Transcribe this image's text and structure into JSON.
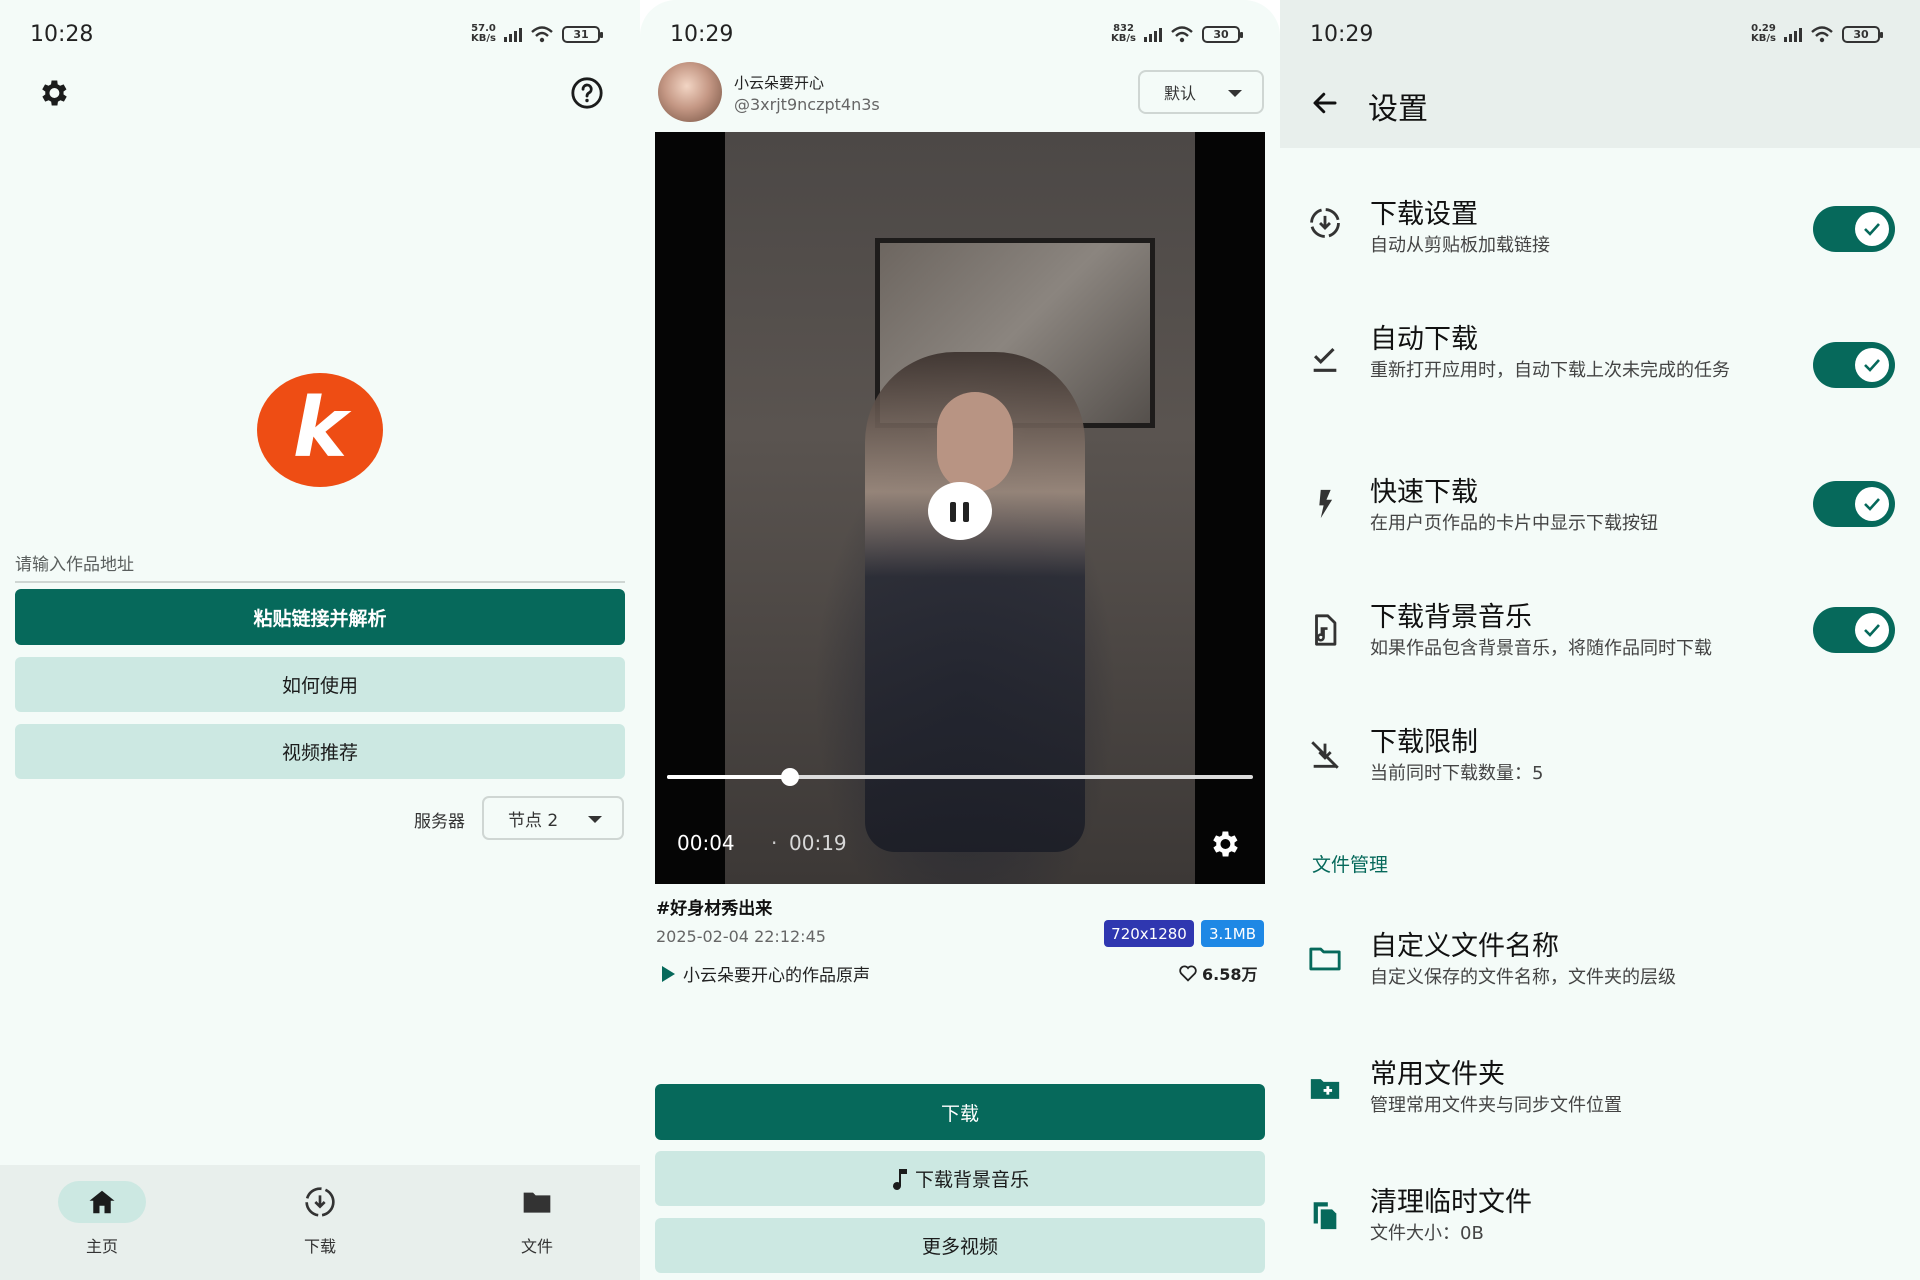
{
  "panel_home": {
    "status": {
      "time": "10:28",
      "net_top": "57.0",
      "net_bottom": "KB/s",
      "battery": "31"
    },
    "logo_letter": "k",
    "url_input": {
      "placeholder": "请输入作品地址"
    },
    "paste_button": "粘贴链接并解析",
    "howto_button": "如何使用",
    "recommend_button": "视频推荐",
    "server_label": "服务器",
    "server_value": "节点 2",
    "nav": [
      {
        "label": "主页",
        "icon": "home-icon",
        "active": true
      },
      {
        "label": "下载",
        "icon": "download-icon",
        "active": false
      },
      {
        "label": "文件",
        "icon": "folder-icon",
        "active": false
      }
    ]
  },
  "panel_video": {
    "status": {
      "time": "10:29",
      "net_top": "832",
      "net_bottom": "KB/s",
      "battery": "30"
    },
    "author": {
      "name": "小云朵要开心",
      "handle": "@3xrjt9nczpt4n3s"
    },
    "sort_value": "默认",
    "player": {
      "current_time": "00:04",
      "separator": "·",
      "total_time": "00:19",
      "progress": 0.21
    },
    "post": {
      "title": "#好身材秀出来",
      "date": "2025-02-04 22:12:45",
      "resolution": "720x1280",
      "size": "3.1MB",
      "music": "小云朵要开心的作品原声",
      "likes": "6.58万"
    },
    "download_button": "下载",
    "download_music_button": "下载背景音乐",
    "more_videos_button": "更多视频"
  },
  "panel_settings": {
    "status": {
      "time": "10:29",
      "net_top": "0.29",
      "net_bottom": "KB/s",
      "battery": "30"
    },
    "title": "设置",
    "items": [
      {
        "title": "下载设置",
        "desc": "自动从剪贴板加载链接",
        "icon": "download-circle-icon",
        "toggle": true
      },
      {
        "title": "自动下载",
        "desc": "重新打开应用时，自动下载上次未完成的任务",
        "icon": "check-download-icon",
        "toggle": true
      },
      {
        "title": "快速下载",
        "desc": "在用户页作品的卡片中显示下载按钮",
        "icon": "flash-icon",
        "toggle": true
      },
      {
        "title": "下载背景音乐",
        "desc": "如果作品包含背景音乐，将随作品同时下载",
        "icon": "music-file-icon",
        "toggle": true
      },
      {
        "title": "下载限制",
        "desc": "当前同时下载数量：5",
        "icon": "download-off-icon",
        "toggle": null
      }
    ],
    "section_file": "文件管理",
    "file_items": [
      {
        "title": "自定义文件名称",
        "desc": "自定义保存的文件名称，文件夹的层级",
        "icon": "folder-outline-icon"
      },
      {
        "title": "常用文件夹",
        "desc": "管理常用文件夹与同步文件位置",
        "icon": "folder-plus-icon"
      },
      {
        "title": "清理临时文件",
        "desc": "文件大小：0B",
        "icon": "copy-files-icon"
      }
    ]
  },
  "colors": {
    "primary": "#06695b",
    "tonal": "#cce8e2",
    "background": "#f4fbf8",
    "logo": "#ee4d14",
    "badge_res": "#2f37b0",
    "badge_size": "#1e88e5"
  }
}
